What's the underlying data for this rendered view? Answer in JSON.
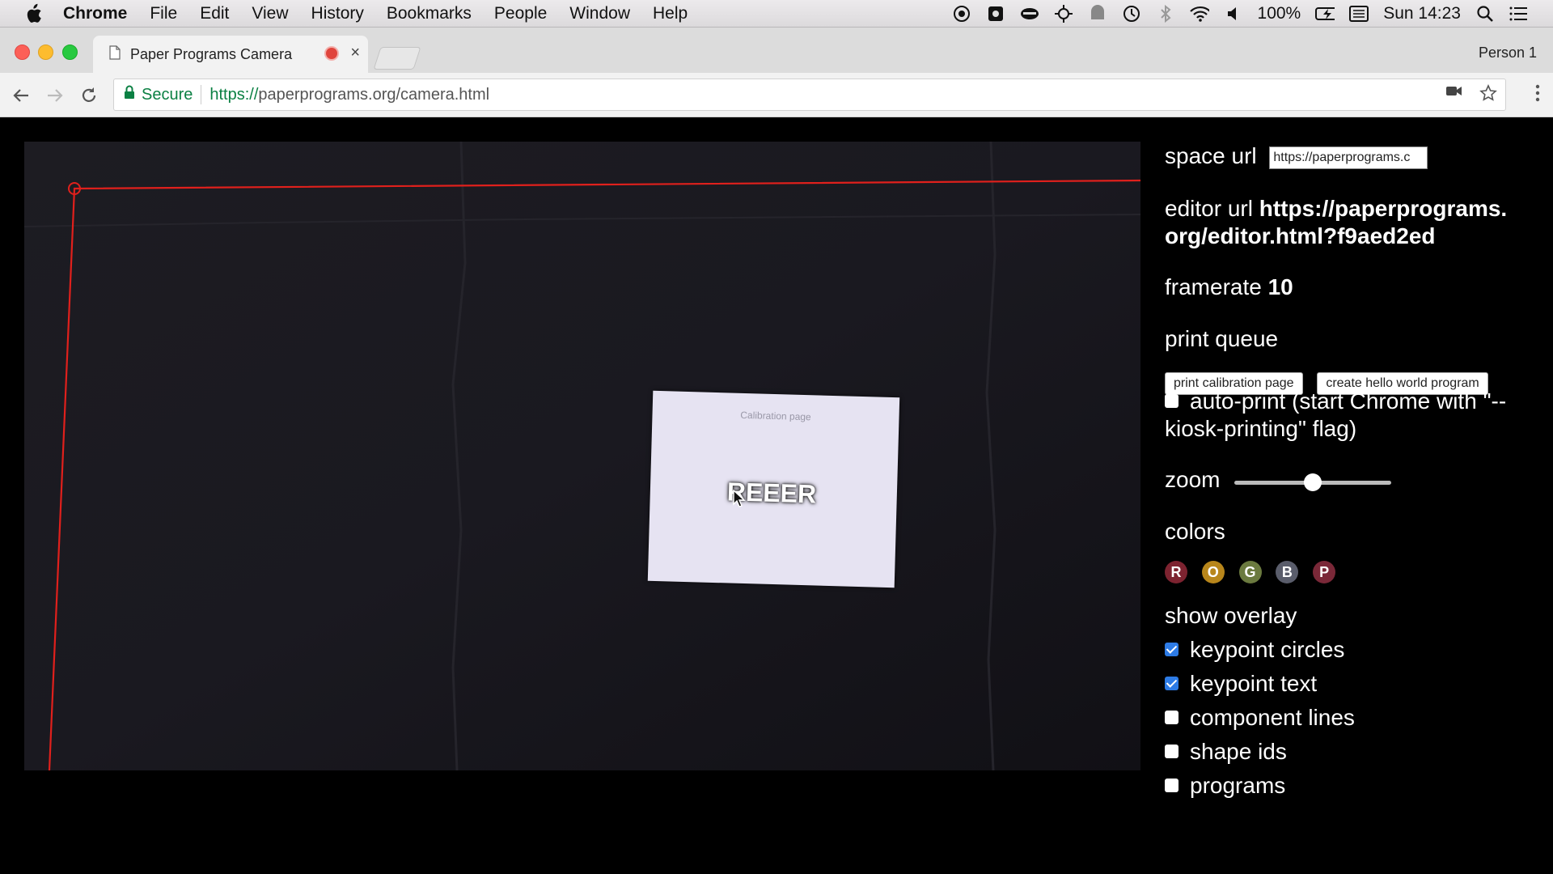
{
  "menubar": {
    "app": "Chrome",
    "items": [
      "File",
      "Edit",
      "View",
      "History",
      "Bookmarks",
      "People",
      "Window",
      "Help"
    ],
    "battery": "100%",
    "clock": "Sun 14:23"
  },
  "tab": {
    "title": "Paper Programs Camera",
    "close_glyph": "×"
  },
  "profile": "Person 1",
  "address": {
    "secure_label": "Secure",
    "url_scheme": "https://",
    "url_rest": "paperprograms.org/camera.html"
  },
  "camera": {
    "paper_title": "Calibration page",
    "paper_dots": "REEER",
    "colors": {
      "frame": "#e0201c"
    }
  },
  "panel": {
    "space_url_label": "space url",
    "space_url_value": "https://paperprograms.c",
    "editor_url_label": "editor url",
    "editor_url_value": "https://paperprograms.org/editor.html?f9aed2ed",
    "framerate_label": "framerate",
    "framerate_value": "10",
    "print_queue_label": "print queue",
    "print_calibration_button": "print calibration page",
    "create_hello_button": "create hello world program",
    "auto_print_label": "auto-print (start Chrome with \"--kiosk-printing\" flag)",
    "zoom_label": "zoom",
    "zoom_value_fraction": 0.5,
    "colors_label": "colors",
    "color_swatches": [
      {
        "letter": "R",
        "color": "#7d2330"
      },
      {
        "letter": "O",
        "color": "#b8861b"
      },
      {
        "letter": "G",
        "color": "#6b7a3f"
      },
      {
        "letter": "B",
        "color": "#5a5d6b"
      },
      {
        "letter": "P",
        "color": "#7a2838"
      }
    ],
    "show_overlay_label": "show overlay",
    "overlay_options": [
      {
        "label": "keypoint circles",
        "checked": true
      },
      {
        "label": "keypoint text",
        "checked": true
      },
      {
        "label": "component lines",
        "checked": false
      },
      {
        "label": "shape ids",
        "checked": false
      },
      {
        "label": "programs",
        "checked": false
      }
    ]
  }
}
